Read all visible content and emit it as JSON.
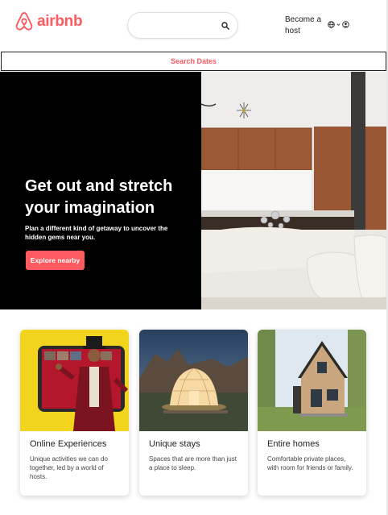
{
  "header": {
    "logo_text": "airbnb",
    "search": {
      "placeholder": ""
    },
    "host_link": "Become a host",
    "globe_icon": "globe-icon",
    "chevron_icon": "chevron-down-icon",
    "profile_icon": "user-circle-icon"
  },
  "search_dates": {
    "label": "Search Dates"
  },
  "hero": {
    "title": "Get out and stretch your imagination",
    "subtitle": "Plan a different kind of getaway to uncover the hidden gems near you.",
    "button_label": "Explore nearby"
  },
  "cards": [
    {
      "title": "Online Experiences",
      "description": "Unique activities we can do together, led by a world of hosts."
    },
    {
      "title": "Unique stays",
      "description": "Spaces that are more than just a place to sleep."
    },
    {
      "title": "Entire homes",
      "description": "Comfortable private places, with room for friends or family."
    }
  ],
  "colors": {
    "brand": "#ff5a5f",
    "text": "#222222",
    "hero_bg": "#000000"
  }
}
